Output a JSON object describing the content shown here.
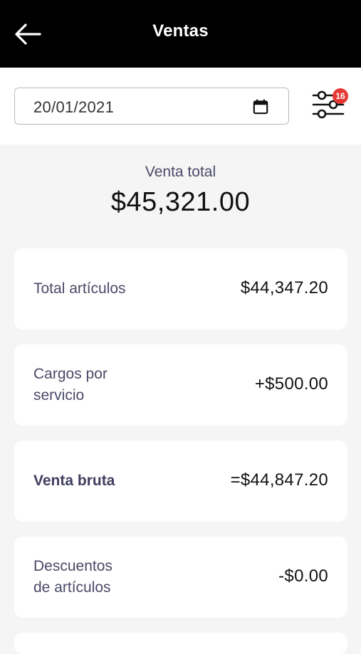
{
  "header": {
    "title": "Ventas",
    "back_icon": "arrow-left-icon"
  },
  "filters": {
    "date_value": "20/01/2021",
    "calendar_icon": "calendar-icon",
    "filter_icon": "sliders-icon",
    "filter_badge_count": "16",
    "badge_color": "#e53935"
  },
  "summary": {
    "label": "Venta total",
    "value": "$45,321.00"
  },
  "rows": [
    {
      "label": "Total artículos",
      "value": "$44,347.20"
    },
    {
      "label_line1": "Cargos por",
      "label_line2": "servicio",
      "value": "+$500.00"
    },
    {
      "label": "Venta bruta",
      "value": "=$44,847.20"
    },
    {
      "label_line1": "Descuentos",
      "label_line2": "de artículos",
      "value": "-$0.00"
    }
  ]
}
